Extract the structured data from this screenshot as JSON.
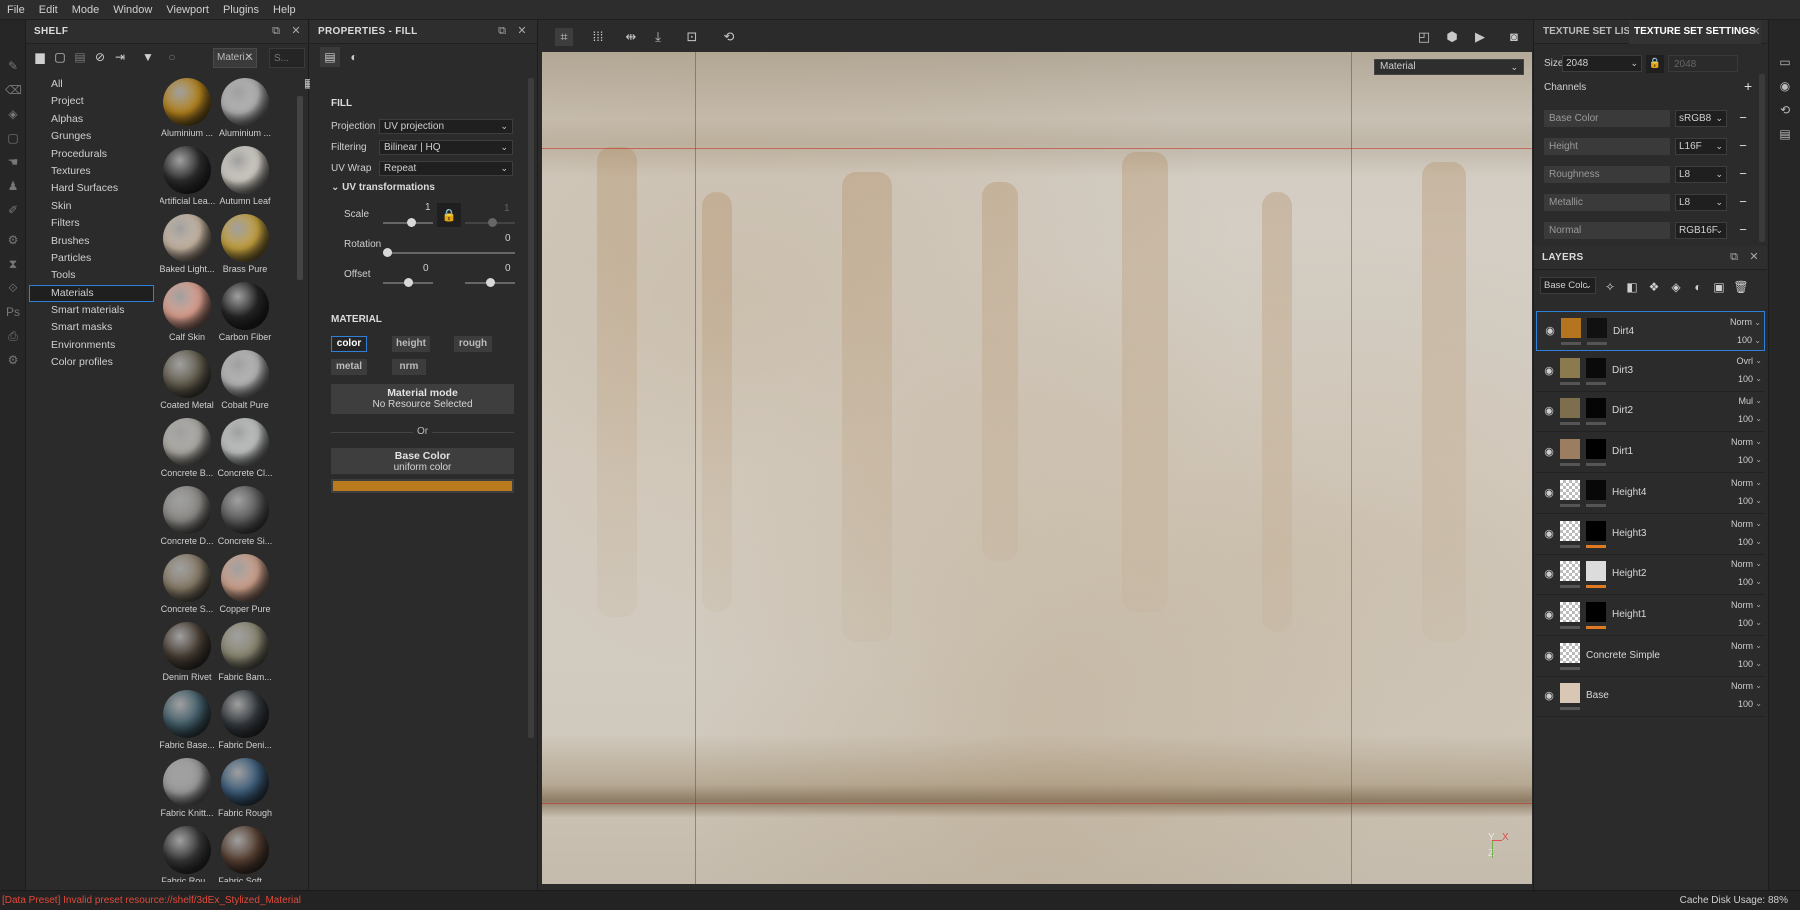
{
  "menu": [
    "File",
    "Edit",
    "Mode",
    "Window",
    "Viewport",
    "Plugins",
    "Help"
  ],
  "shelf": {
    "title": "SHELF",
    "filter_chip": "Materi...",
    "search_placeholder": "S...",
    "categories": [
      "All",
      "Project",
      "Alphas",
      "Grunges",
      "Procedurals",
      "Textures",
      "Hard Surfaces",
      "Skin",
      "Filters",
      "Brushes",
      "Particles",
      "Tools",
      "Materials",
      "Smart materials",
      "Smart masks",
      "Environments",
      "Color profiles"
    ],
    "active_category": "Materials",
    "materials": [
      {
        "label": "Aluminium ...",
        "color": "#b8861f"
      },
      {
        "label": "Aluminium ...",
        "color": "#b9b9b9"
      },
      {
        "label": "Artificial Lea...",
        "color": "#2e2e2e"
      },
      {
        "label": "Autumn Leaf",
        "color": "#d9d4cc"
      },
      {
        "label": "Baked Light...",
        "color": "#cdbba7"
      },
      {
        "label": "Brass Pure",
        "color": "#c9a440"
      },
      {
        "label": "Calf Skin",
        "color": "#e2a493"
      },
      {
        "label": "Carbon Fiber",
        "color": "#262626"
      },
      {
        "label": "Coated Metal",
        "color": "#666050"
      },
      {
        "label": "Cobalt Pure",
        "color": "#bcbcbc"
      },
      {
        "label": "Concrete B...",
        "color": "#b3b0aa"
      },
      {
        "label": "Concrete Cl...",
        "color": "#c6c8c8"
      },
      {
        "label": "Concrete D...",
        "color": "#8f8d89"
      },
      {
        "label": "Concrete Si...",
        "color": "#5f5f5f"
      },
      {
        "label": "Concrete S...",
        "color": "#8b7f6b"
      },
      {
        "label": "Copper Pure",
        "color": "#d3a58f"
      },
      {
        "label": "Denim Rivet",
        "color": "#4a4036"
      },
      {
        "label": "Fabric Bam...",
        "color": "#8d8a74"
      },
      {
        "label": "Fabric Base...",
        "color": "#44606c"
      },
      {
        "label": "Fabric Deni...",
        "color": "#353b40"
      },
      {
        "label": "Fabric Knitt...",
        "color": "#a0a0a0"
      },
      {
        "label": "Fabric Rough",
        "color": "#3d5e7c"
      },
      {
        "label": "Fabric Rou...",
        "color": "#383838"
      },
      {
        "label": "Fabric Soft ...",
        "color": "#5a4234"
      }
    ]
  },
  "properties": {
    "title": "PROPERTIES - FILL",
    "fill_label": "FILL",
    "projection_label": "Projection",
    "projection_value": "UV projection",
    "filtering_label": "Filtering",
    "filtering_value": "Bilinear | HQ",
    "uvwrap_label": "UV Wrap",
    "uvwrap_value": "Repeat",
    "uv_transformations_label": "UV transformations",
    "scale_label": "Scale",
    "scale_value": "1",
    "scale_value_2": "1",
    "rotation_label": "Rotation",
    "rotation_value": "0",
    "offset_label": "Offset",
    "offset_value_1": "0",
    "offset_value_2": "0",
    "material_label": "MATERIAL",
    "channels": [
      "color",
      "height",
      "rough",
      "metal",
      "nrm"
    ],
    "active_channel": "color",
    "material_mode_title": "Material mode",
    "material_mode_sub": "No Resource Selected",
    "or_label": "Or",
    "base_color_title": "Base Color",
    "base_color_sub": "uniform color",
    "base_color_swatch": "#b97a1e"
  },
  "viewport": {
    "mode_dropdown": "Material",
    "axis_y": "Y",
    "axis_x": "X",
    "axis_z": "Z"
  },
  "texture_set": {
    "tab_list": "TEXTURE SET LIST",
    "tab_settings": "TEXTURE SET SETTINGS",
    "size_label": "Size",
    "size_value": "2048",
    "size_locked_value": "2048",
    "channels_label": "Channels",
    "channels": [
      {
        "name": "Base Color",
        "format": "sRGB8"
      },
      {
        "name": "Height",
        "format": "L16F"
      },
      {
        "name": "Roughness",
        "format": "L8"
      },
      {
        "name": "Metallic",
        "format": "L8"
      },
      {
        "name": "Normal",
        "format": "RGB16F"
      }
    ]
  },
  "layers": {
    "title": "LAYERS",
    "channel_select": "Base Colc",
    "items": [
      {
        "name": "Dirt4",
        "blend": "Norm",
        "opacity": "100",
        "thumb": "#b5741e",
        "mask": "#111",
        "bar": "#555"
      },
      {
        "name": "Dirt3",
        "blend": "Ovrl",
        "opacity": "100",
        "thumb": "#8a7a4d",
        "mask": "#0a0a0a",
        "bar": "#555"
      },
      {
        "name": "Dirt2",
        "blend": "Mul",
        "opacity": "100",
        "thumb": "#7d6f4d",
        "mask": "#050505",
        "bar": "#555"
      },
      {
        "name": "Dirt1",
        "blend": "Norm",
        "opacity": "100",
        "thumb": "#9b7d5f",
        "mask": "#000",
        "bar": "#555"
      },
      {
        "name": "Height4",
        "blend": "Norm",
        "opacity": "100",
        "thumb": "checker",
        "mask": "#080808",
        "bar": "#555"
      },
      {
        "name": "Height3",
        "blend": "Norm",
        "opacity": "100",
        "thumb": "checker",
        "mask": "#000",
        "bar": "#e07a22"
      },
      {
        "name": "Height2",
        "blend": "Norm",
        "opacity": "100",
        "thumb": "checker",
        "mask": "#dcdcdc",
        "bar": "#e07a22"
      },
      {
        "name": "Height1",
        "blend": "Norm",
        "opacity": "100",
        "thumb": "checker",
        "mask": "#000",
        "bar": "#e07a22"
      },
      {
        "name": "Concrete Simple",
        "blend": "Norm",
        "opacity": "100",
        "thumb": "checker",
        "mask": "",
        "bar": ""
      },
      {
        "name": "Base",
        "blend": "Norm",
        "opacity": "100",
        "thumb": "#d7c7b4",
        "mask": "",
        "bar": ""
      }
    ]
  },
  "status": {
    "message": "[Data Preset] Invalid preset resource://shelf/3dEx_Stylized_Material",
    "cache": "Cache Disk Usage:    88%"
  }
}
